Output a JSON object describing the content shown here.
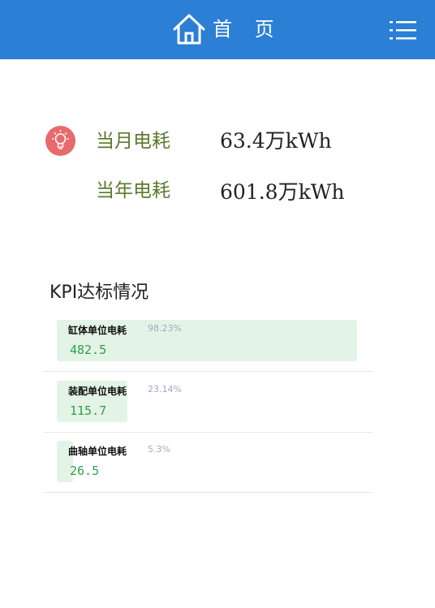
{
  "header": {
    "title": "首 页",
    "home_icon": "home-icon",
    "menu_icon": "list-menu-icon",
    "background": "#2b7fd4"
  },
  "energy": {
    "icon": "lightbulb-icon",
    "month_label": "当月电耗",
    "month_value": "63.4万kWh",
    "year_label": "当年电耗",
    "year_value": "601.8万kWh"
  },
  "kpi": {
    "title": "KPI达标情况",
    "items": [
      {
        "name": "缸体单位电耗",
        "percent_text": "98.23%",
        "percent": 98.23,
        "value": "482.5"
      },
      {
        "name": "装配单位电耗",
        "percent_text": "23.14%",
        "percent": 23.14,
        "value": "115.7"
      },
      {
        "name": "曲轴单位电耗",
        "percent_text": "5.3%",
        "percent": 5.3,
        "value": "26.5"
      }
    ]
  }
}
